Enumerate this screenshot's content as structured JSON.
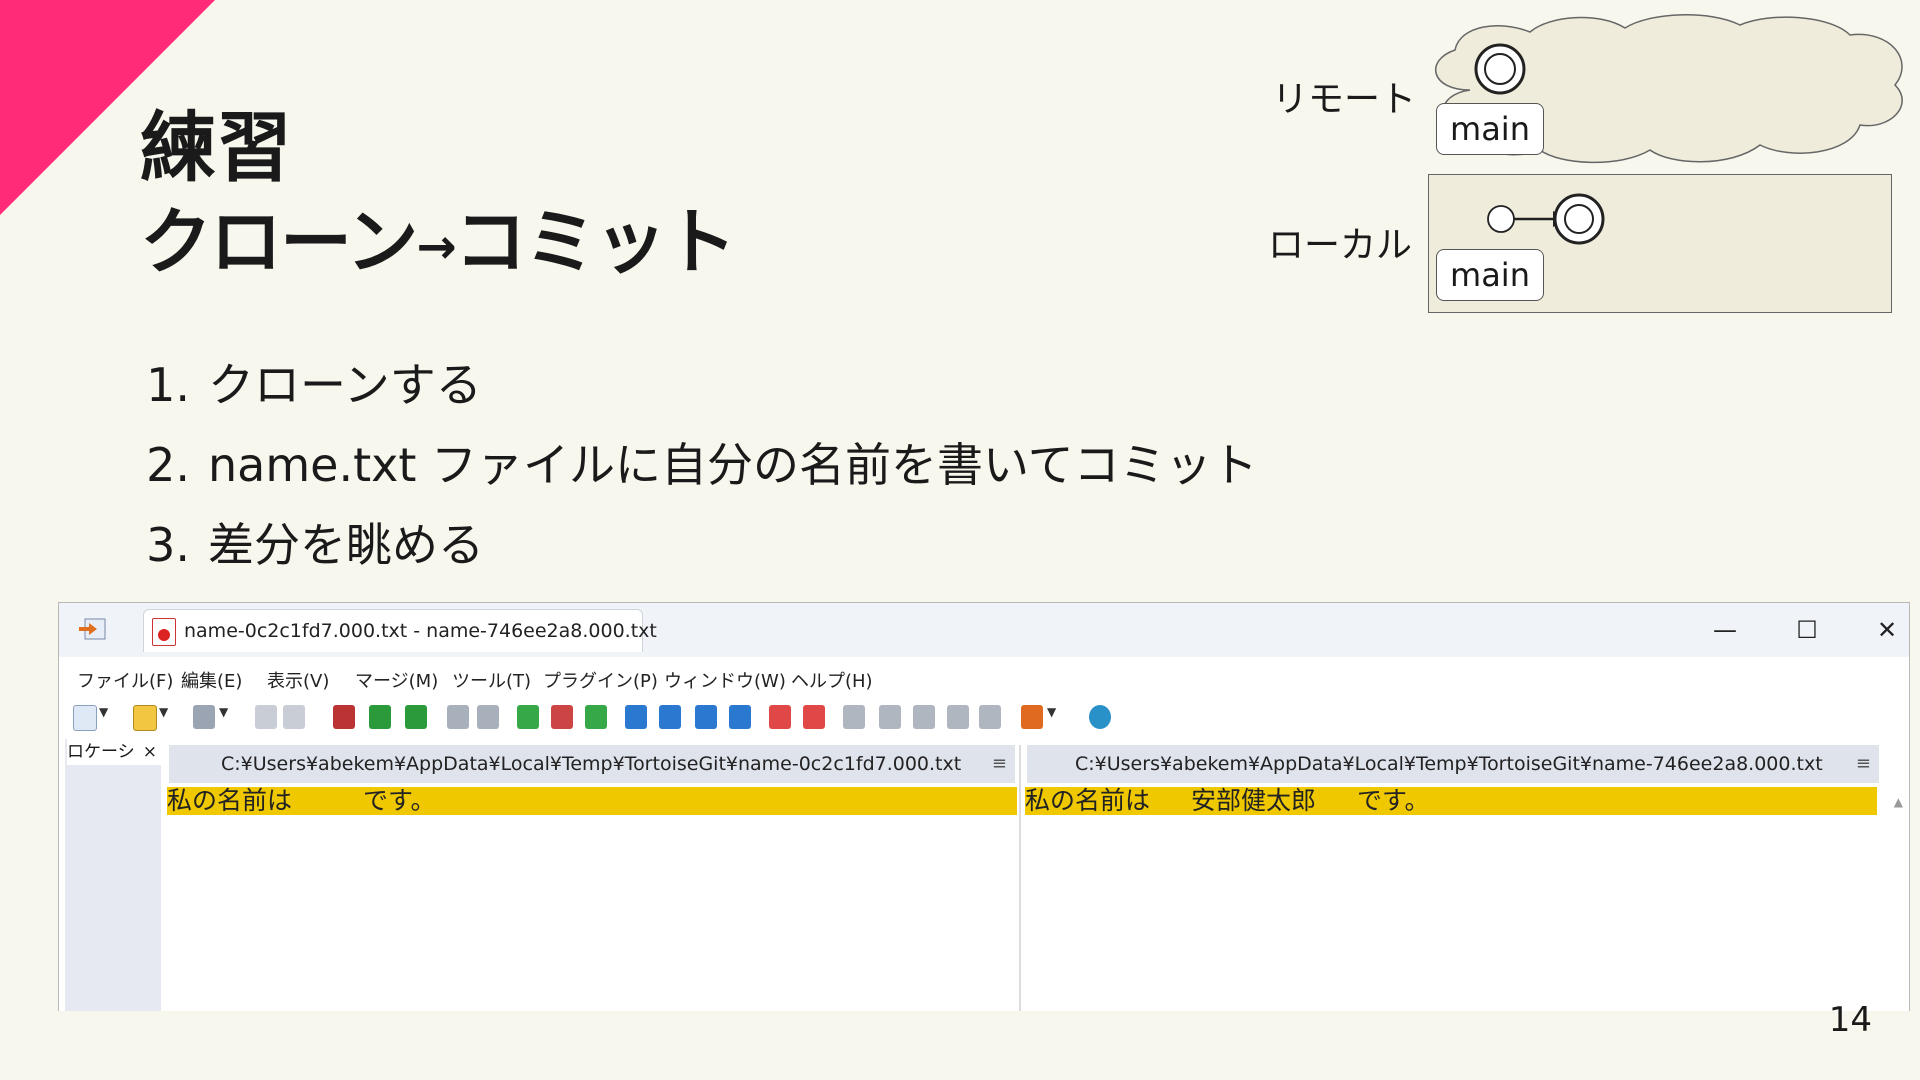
{
  "slide": {
    "title_line1": "練習",
    "title_line2a": "クローン",
    "title_arrow": "→",
    "title_line2b": "コミット",
    "steps": [
      {
        "num": "1.",
        "text": "クローンする"
      },
      {
        "num": "2.",
        "text": "name.txt ファイルに自分の名前を書いてコミット"
      },
      {
        "num": "3.",
        "text": "差分を眺める"
      }
    ],
    "page_number": "14",
    "accent_color": "#ff2a78"
  },
  "diagram": {
    "remote_label": "リモート",
    "local_label": "ローカル",
    "remote_branch": "main",
    "local_branch": "main"
  },
  "window": {
    "tab_title": "name-0c2c1fd7.000.txt - name-746ee2a8.000.txt",
    "minimize": "—",
    "maximize": "☐",
    "close": "✕",
    "menu": [
      "ファイル(F)",
      "編集(E)",
      "表示(V)",
      "マージ(M)",
      "ツール(T)",
      "プラグイン(P)",
      "ウィンドウ(W)",
      "ヘルプ(H)"
    ],
    "location_pane_label": "ロケーシ",
    "location_close": "×",
    "left_path": "C:¥Users¥abekem¥AppData¥Local¥Temp¥TortoiseGit¥name-0c2c1fd7.000.txt",
    "right_path": "C:¥Users¥abekem¥AppData¥Local¥Temp¥TortoiseGit¥name-746ee2a8.000.txt",
    "pane_menu_icon": "≡",
    "left_line": {
      "a": "私の名前は",
      "b": "です。"
    },
    "right_line": {
      "a": "私の名前は",
      "name": "安部健太郎",
      "b": "です。"
    },
    "diff_color": "#f0c800"
  }
}
